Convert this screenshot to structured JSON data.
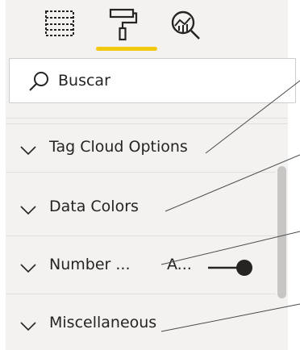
{
  "toolbar": {
    "tools": [
      {
        "icon": "fields-grid-icon",
        "active": false
      },
      {
        "icon": "paint-roller-icon",
        "active": true
      },
      {
        "icon": "analytics-magnifier-icon",
        "active": false
      }
    ],
    "active_color": "#f2c811"
  },
  "search": {
    "placeholder": "Buscar",
    "icon": "search-icon"
  },
  "sections": [
    {
      "label": "Tag Cloud Options"
    },
    {
      "label": "Data Colors"
    },
    {
      "label": "Number ...",
      "extra": "A...",
      "toggle_on": true
    },
    {
      "label": "Miscellaneous"
    }
  ],
  "colors": {
    "pane_background": "#f3f2f1",
    "text": "#252423",
    "accent": "#f2c811",
    "icon": "#252423",
    "callout_line": "#4a4a4a"
  }
}
